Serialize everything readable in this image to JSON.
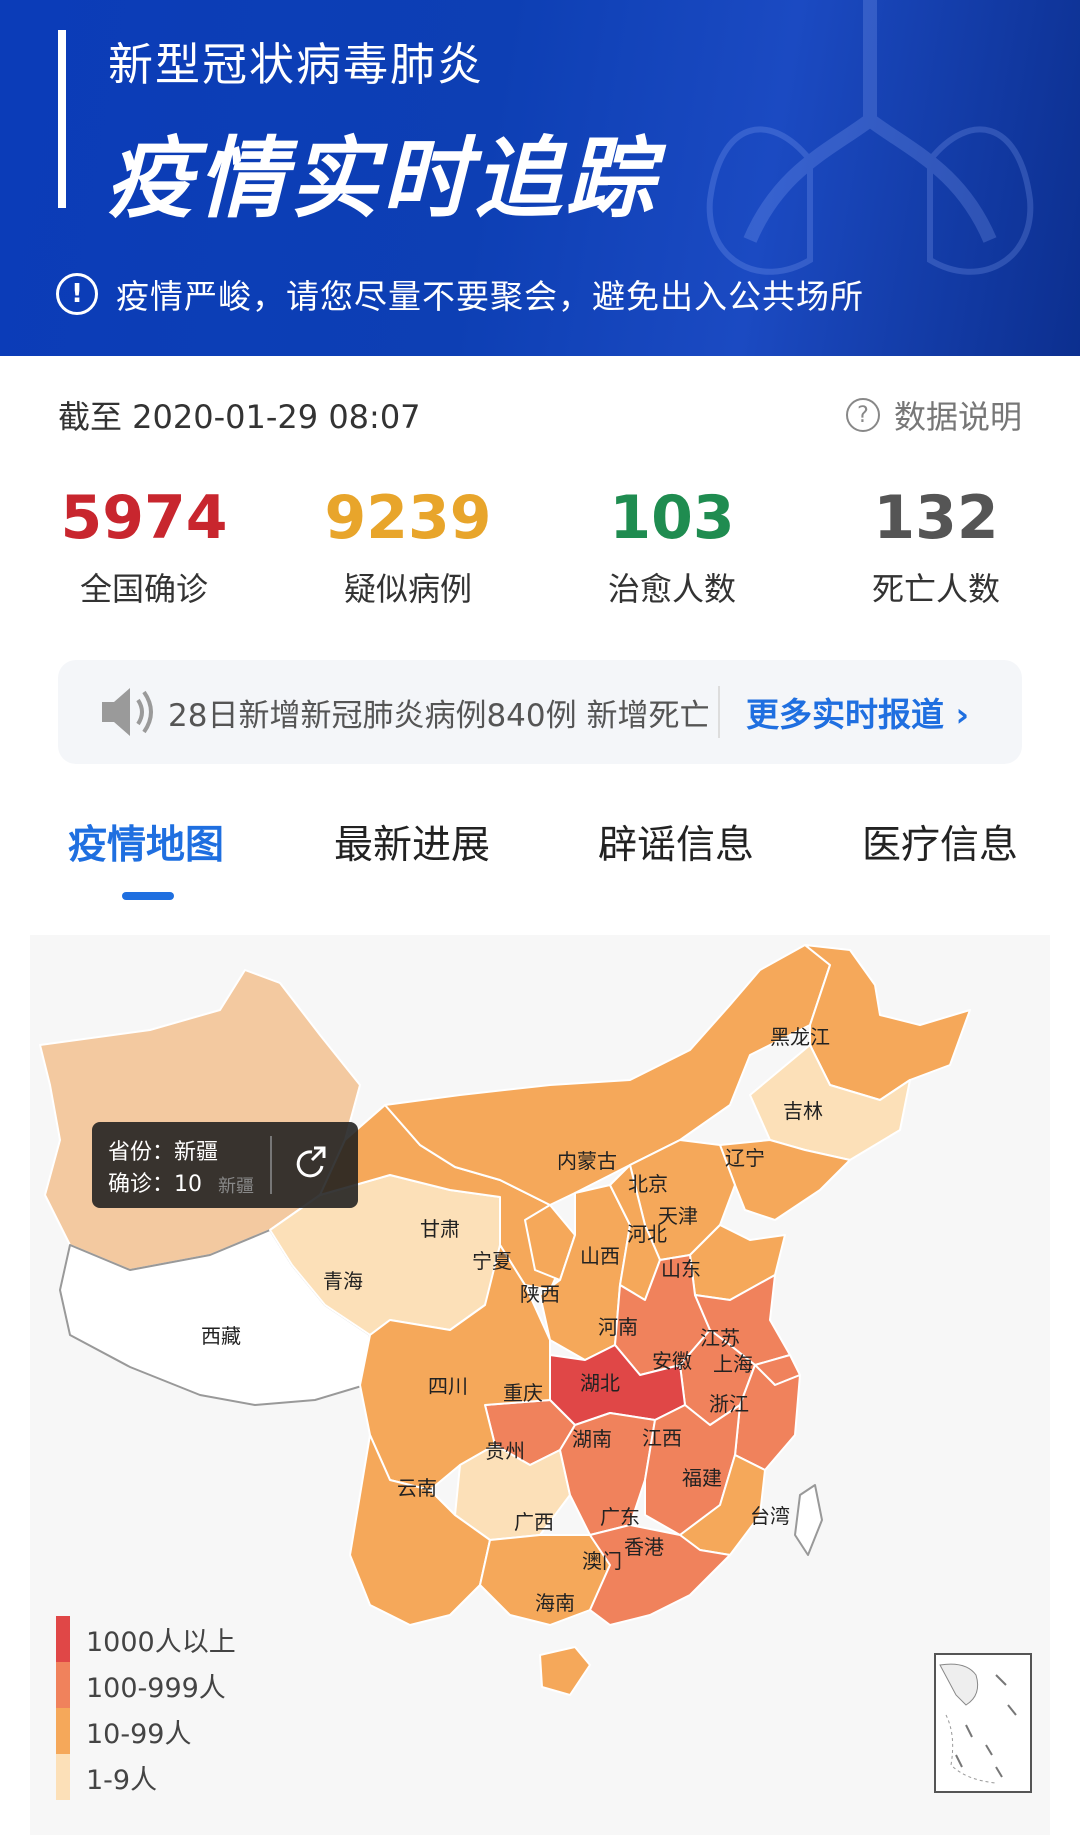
{
  "banner": {
    "subtitle": "新型冠状病毒肺炎",
    "title": "疫情实时追踪",
    "warning": "疫情严峻，请您尽量不要聚会，避免出入公共场所",
    "warning_icon": "exclamation-icon"
  },
  "update": {
    "as_of": "截至 2020-01-29 08:07",
    "data_explain": "数据说明",
    "data_explain_icon": "question-icon"
  },
  "stats": [
    {
      "value": "5974",
      "label": "全国确诊",
      "color": "#c8262e"
    },
    {
      "value": "9239",
      "label": "疑似病例",
      "color": "#e8a52b"
    },
    {
      "value": "103",
      "label": "治愈人数",
      "color": "#1f8c50"
    },
    {
      "value": "132",
      "label": "死亡人数",
      "color": "#555555"
    }
  ],
  "ticker": {
    "icon": "speaker-icon",
    "text": "28日新增新冠肺炎病例840例 新增死亡",
    "more": "更多实时报道 ›"
  },
  "tabs": [
    {
      "label": "疫情地图",
      "active": true
    },
    {
      "label": "最新进展",
      "active": false
    },
    {
      "label": "辟谣信息",
      "active": false
    },
    {
      "label": "医疗信息",
      "active": false
    }
  ],
  "map": {
    "tooltip": {
      "province_line": "省份：新疆",
      "confirmed_line": "确诊：10",
      "ghost": "新疆",
      "share_icon": "share-icon"
    },
    "provinces": [
      "黑龙江",
      "吉林",
      "辽宁",
      "内蒙古",
      "北京",
      "天津",
      "河北",
      "山西",
      "山东",
      "甘肃",
      "宁夏",
      "青海",
      "陕西",
      "河南",
      "江苏",
      "西藏",
      "安徽",
      "上海",
      "四川",
      "重庆",
      "湖北",
      "浙江",
      "贵州",
      "湖南",
      "江西",
      "福建",
      "云南",
      "台湾",
      "广西",
      "广东",
      "香港",
      "澳门",
      "海南"
    ],
    "legend": [
      {
        "label": "1000人以上",
        "color": "#e04747"
      },
      {
        "label": "100-999人",
        "color": "#f0825c"
      },
      {
        "label": "10-99人",
        "color": "#f5a85a"
      },
      {
        "label": "1-9人",
        "color": "#fce0b8"
      }
    ]
  }
}
